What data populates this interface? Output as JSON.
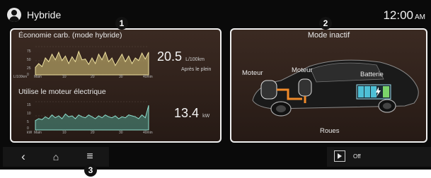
{
  "header": {
    "profile_name": "Hybride",
    "time": "12:00",
    "ampm": "AM"
  },
  "fuel_panel": {
    "title": "Économie carb. (mode hybride)",
    "value": "20.5",
    "unit": "L/100km",
    "sub": "Après le plein",
    "y_ticks": [
      "75",
      "50",
      "25",
      "0"
    ],
    "y_unit": "L/100km",
    "x_ticks": [
      "Main",
      "10",
      "20",
      "30",
      "40min"
    ]
  },
  "motor_panel": {
    "title": "Utilise le moteur électrique",
    "value": "13.4",
    "unit": "kW",
    "y_ticks": [
      "15",
      "10",
      "5",
      "0"
    ],
    "y_unit": "kW",
    "x_ticks": [
      "Main",
      "10",
      "20",
      "30",
      "40min"
    ]
  },
  "mode_panel": {
    "title": "Mode inactif",
    "labels": {
      "engine": "Moteur",
      "motor": "Moteur",
      "battery": "Batterie",
      "wheels": "Roues"
    }
  },
  "callouts": [
    "1",
    "2",
    "3"
  ],
  "nav": {
    "back": "‹",
    "home": "⌂",
    "menu": "≡"
  },
  "media": {
    "status": "Off"
  },
  "icons": [
    "user-avatar-icon",
    "back-icon",
    "home-icon",
    "menu-icon",
    "play-icon",
    "battery-icon",
    "lightning-icon",
    "car-icon"
  ],
  "colors": {
    "card_border": "#f0f0f0",
    "fuel_area": "#d9c77a",
    "motor_area": "#4f9a8a",
    "battery": "#4ec0d6",
    "energy_flow": "#f08a2a"
  },
  "chart_data": [
    {
      "type": "area",
      "title": "Économie carb. (mode hybride)",
      "ylabel": "L/100km",
      "ylim": [
        0,
        75
      ],
      "x_ticks": [
        "Main",
        "10",
        "20",
        "30",
        "40min"
      ],
      "values": [
        20,
        30,
        22,
        45,
        35,
        55,
        40,
        60,
        38,
        50,
        30,
        48,
        35,
        62,
        40,
        42,
        28,
        45,
        30,
        55,
        40,
        60,
        35,
        45,
        25,
        40,
        55,
        35,
        50,
        30,
        45,
        38,
        58,
        42,
        60
      ]
    },
    {
      "type": "area",
      "title": "Utilise le moteur électrique",
      "ylabel": "kW",
      "ylim": [
        0,
        15
      ],
      "x_ticks": [
        "Main",
        "10",
        "20",
        "30",
        "40min"
      ],
      "values": [
        5,
        6,
        5.5,
        7,
        6,
        8,
        6.5,
        7.5,
        6,
        8.5,
        7,
        7.5,
        6,
        8,
        7,
        6.5,
        8,
        7,
        6,
        7.5,
        6.5,
        8,
        7,
        6.5,
        7.5,
        6,
        7,
        6.5,
        8,
        7.5,
        7,
        6,
        8,
        6.5,
        13
      ]
    }
  ]
}
